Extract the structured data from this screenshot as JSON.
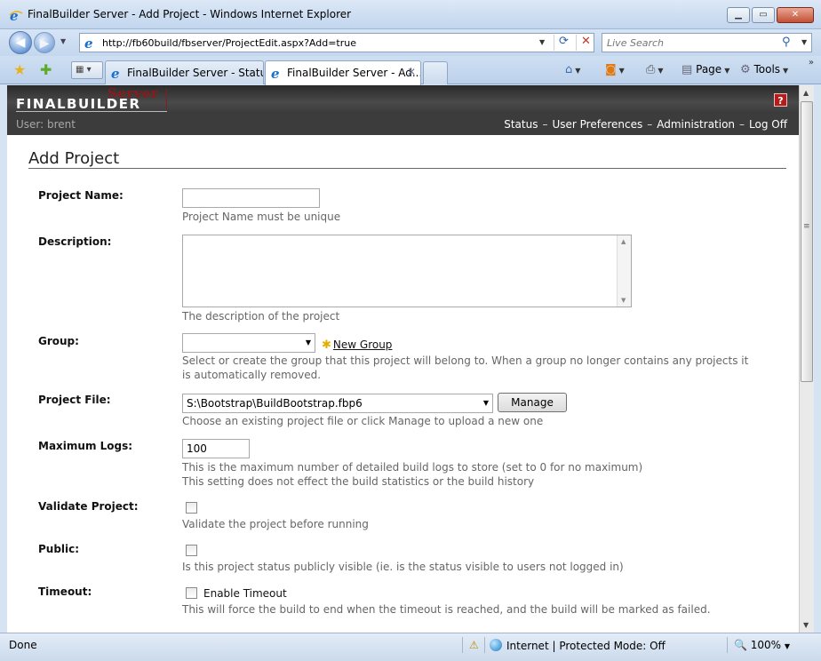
{
  "window": {
    "title": "FinalBuilder Server - Add Project - Windows Internet Explorer"
  },
  "address_bar": {
    "url": "http://fb60build/fbserver/ProjectEdit.aspx?Add=true"
  },
  "search": {
    "placeholder": "Live Search"
  },
  "tabs": [
    {
      "label": "FinalBuilder Server - Status"
    },
    {
      "label": "FinalBuilder Server - Ad..."
    }
  ],
  "commands": {
    "page": "Page",
    "tools": "Tools"
  },
  "header": {
    "logo_server": "Server",
    "logo_main": "FINALBUILDER",
    "help": "?",
    "user": "User: brent",
    "nav": [
      "Status",
      "User Preferences",
      "Administration",
      "Log Off"
    ],
    "nav_sep": "–"
  },
  "page": {
    "title": "Add Project"
  },
  "form": {
    "project_name": {
      "label": "Project Name:",
      "value": "",
      "help": "Project Name must be unique"
    },
    "description": {
      "label": "Description:",
      "value": "",
      "help": "The description of the project"
    },
    "group": {
      "label": "Group:",
      "selected": "",
      "new_group": "New Group",
      "help": "Select or create the group that this project will belong to. When a group no longer contains any projects it is automatically removed."
    },
    "project_file": {
      "label": "Project File:",
      "selected": "S:\\Bootstrap\\BuildBootstrap.fbp6",
      "manage_button": "Manage",
      "help": "Choose an existing project file or click Manage to upload a new one"
    },
    "maximum_logs": {
      "label": "Maximum Logs:",
      "value": "100",
      "help_line1": "This is the maximum number of detailed build logs to store (set to 0 for no maximum)",
      "help_line2": "This setting does not effect the build statistics or the build history"
    },
    "validate_project": {
      "label": "Validate Project:",
      "checked": false,
      "help": "Validate the project before running"
    },
    "public": {
      "label": "Public:",
      "checked": false,
      "help": "Is this project status publicly visible (ie. is the status visible to users not logged in)"
    },
    "timeout": {
      "label": "Timeout:",
      "checked": false,
      "checkbox_label": "Enable Timeout",
      "help": "This will force the build to end when the timeout is reached, and the build will be marked as failed."
    }
  },
  "status_bar": {
    "status": "Done",
    "zone": "Internet | Protected Mode: Off",
    "zoom": "100%"
  }
}
